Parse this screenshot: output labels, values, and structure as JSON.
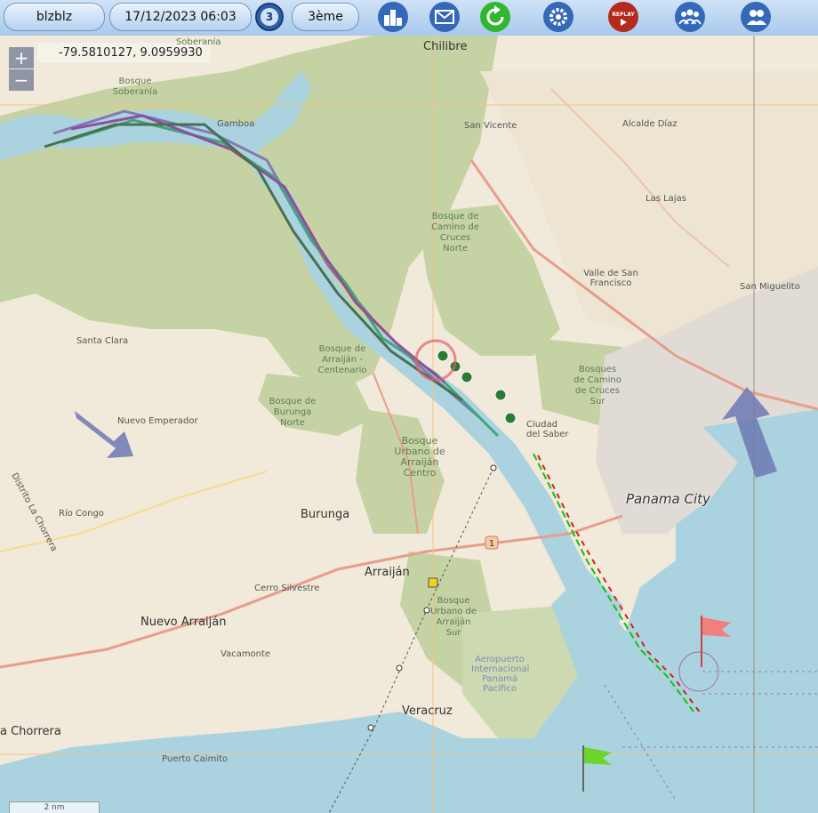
{
  "toolbar": {
    "username": "blzblz",
    "datetime": "17/12/2023 06:03",
    "speed_badge": "3",
    "rank": "3ème",
    "icons": [
      "clock-icon",
      "leaderboard-icon",
      "mail-icon",
      "refresh-icon",
      "settings-icon",
      "replay-icon",
      "group-icon",
      "profile-icon"
    ],
    "replay_label": "REPLAY"
  },
  "map": {
    "coordinates": "-79.5810127, 9.0959930",
    "zoom_in": "+",
    "zoom_out": "−",
    "scale_label": "2 nm",
    "places": {
      "chilibre": "Chilibre",
      "san_vicente": "San Vicente",
      "alcalde_diaz": "Alcalde Díaz",
      "las_lajas": "Las Lajas",
      "san_miguelito": "San Miguelito",
      "valle_san_francisco": "Valle de San Francisco",
      "gamboa": "Gamboa",
      "soberania_top": "Soberanía",
      "bosque_soberania": "Bosque Soberanía",
      "bosque_cruces_norte": "Bosque de Camino de Cruces Norte",
      "bosque_cruces_sur": "Bosques de Camino de Cruces Sur",
      "bosque_arraijan_centenario": "Bosque de Arraiján - Centenario",
      "bosque_burunga_norte": "Bosque de Burunga Norte",
      "bosque_urbano_arraijan_centro": "Bosque Urbano de Arraiján Centro",
      "bosque_urbano_arraijan_sur": "Bosque Urbano de Arraiján Sur",
      "santa_clara": "Santa Clara",
      "nuevo_emperador": "Nuevo Emperador",
      "distrito_la_chorrera": "Distrito La Chorrera",
      "rio_congo": "Río Congo",
      "burunga": "Burunga",
      "arraijan": "Arraiján",
      "cerro_silvestre": "Cerro Silvestre",
      "nuevo_arraijan": "Nuevo Arraiján",
      "vacamonte": "Vacamonte",
      "veracruz": "Veracruz",
      "la_chorrera": "a Chorrera",
      "puerto_caimito": "Puerto Caimito",
      "ciudad_del_saber": "Ciudad del Saber",
      "panama_city": "Panama City",
      "aeropuerto": "Aeropuerto Internacional Panamá Pacífico",
      "route_1": "1"
    },
    "colors": {
      "water": "#aad3df",
      "land": "#f1e9d9",
      "forest": "#c5d3a4",
      "urban": "#e0dbd4",
      "road": "#e89d8c",
      "route_purple": "#7b6bb0",
      "boat_green": "#11c311",
      "boat_red": "#d62020",
      "flag_red": "#f08080",
      "flag_green": "#6dd42a",
      "wind_arrow": "#6c78b3"
    }
  }
}
